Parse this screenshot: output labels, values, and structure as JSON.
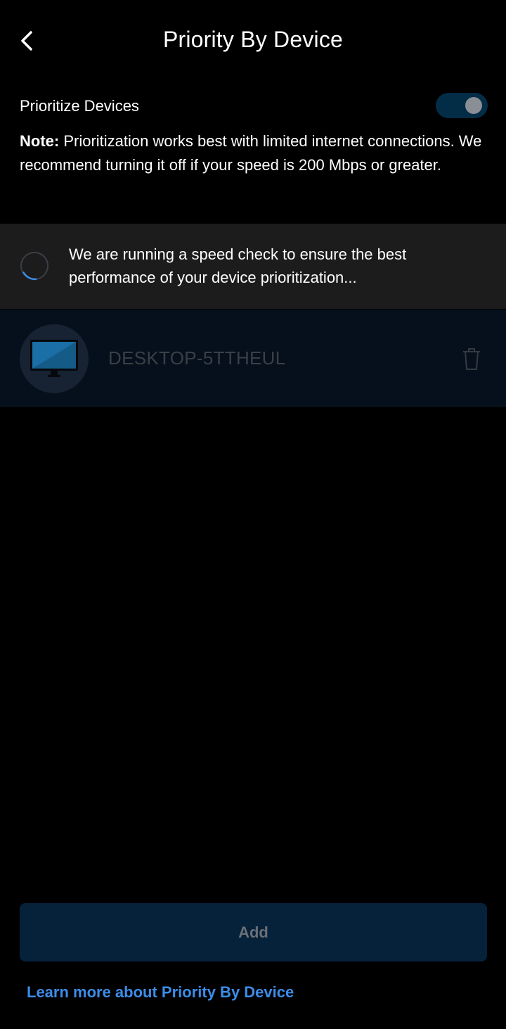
{
  "header": {
    "title": "Priority By Device",
    "back_icon": "chevron-left-icon"
  },
  "prioritize": {
    "label": "Prioritize Devices",
    "enabled": true
  },
  "note": {
    "prefix": "Note:",
    "text": " Prioritization works best with limited internet connections. We recommend turning it off if your speed is 200 Mbps or greater."
  },
  "speed_check": {
    "icon": "loading-spinner-icon",
    "message": "We are running a speed check to ensure the best performance of your device prioritization..."
  },
  "devices": [
    {
      "name": "DESKTOP-5TTHEUL",
      "icon": "desktop-monitor-icon",
      "action_icon": "trash-icon"
    }
  ],
  "footer": {
    "add_label": "Add",
    "learn_more": "Learn more about Priority By Device"
  },
  "colors": {
    "background": "#000000",
    "text": "#ffffff",
    "panel": "#1c1c1c",
    "device_row": "#06101c",
    "device_text": "#3a3f46",
    "avatar_bg": "#172333",
    "toggle_track": "#032c47",
    "toggle_knob": "#8a8f96",
    "add_button_bg": "#06213a",
    "add_button_text": "#6b7077",
    "link": "#3d8ce8",
    "spinner_track": "#3a3f46",
    "spinner_arc": "#3d8ce8",
    "monitor_screen": "#1a6fa6",
    "trash_stroke": "#343a42"
  }
}
